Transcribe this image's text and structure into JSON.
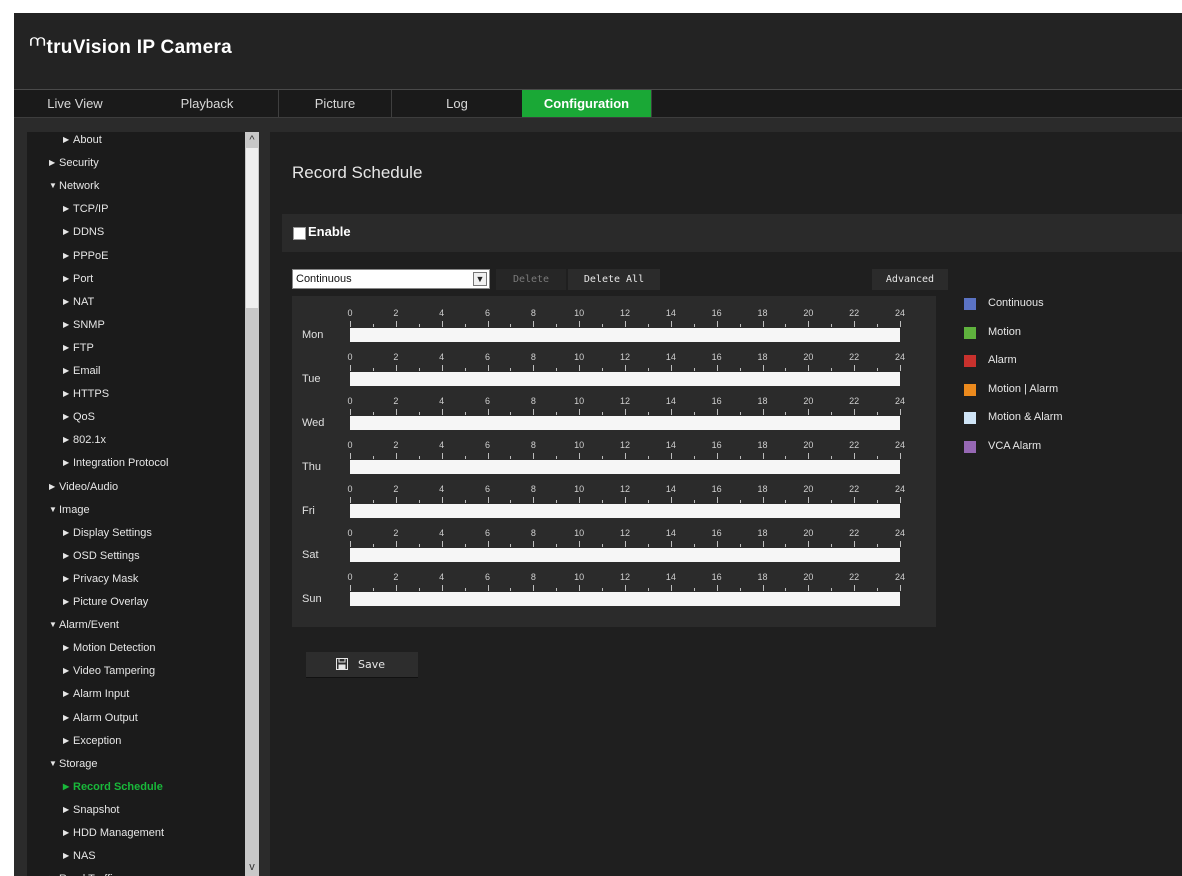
{
  "app": {
    "title": "truVision IP Camera",
    "logo_mark": "⩋"
  },
  "nav": {
    "tabs": [
      {
        "label": "Live View"
      },
      {
        "label": "Playback"
      },
      {
        "label": "Picture"
      },
      {
        "label": "Log"
      },
      {
        "label": "Configuration",
        "active": true
      }
    ]
  },
  "sidebar": {
    "items": [
      {
        "label": "About",
        "level": 1,
        "arrow": "▶"
      },
      {
        "label": "Security",
        "level": 0,
        "arrow": "▶"
      },
      {
        "label": "Network",
        "level": 0,
        "arrow": "▼"
      },
      {
        "label": "TCP/IP",
        "level": 1,
        "arrow": "▶"
      },
      {
        "label": "DDNS",
        "level": 1,
        "arrow": "▶"
      },
      {
        "label": "PPPoE",
        "level": 1,
        "arrow": "▶"
      },
      {
        "label": "Port",
        "level": 1,
        "arrow": "▶"
      },
      {
        "label": "NAT",
        "level": 1,
        "arrow": "▶"
      },
      {
        "label": "SNMP",
        "level": 1,
        "arrow": "▶"
      },
      {
        "label": "FTP",
        "level": 1,
        "arrow": "▶"
      },
      {
        "label": "Email",
        "level": 1,
        "arrow": "▶"
      },
      {
        "label": "HTTPS",
        "level": 1,
        "arrow": "▶"
      },
      {
        "label": "QoS",
        "level": 1,
        "arrow": "▶"
      },
      {
        "label": "802.1x",
        "level": 1,
        "arrow": "▶"
      },
      {
        "label": "Integration Protocol",
        "level": 1,
        "arrow": "▶"
      },
      {
        "label": "Video/Audio",
        "level": 0,
        "arrow": "▶"
      },
      {
        "label": "Image",
        "level": 0,
        "arrow": "▼"
      },
      {
        "label": "Display Settings",
        "level": 1,
        "arrow": "▶"
      },
      {
        "label": "OSD Settings",
        "level": 1,
        "arrow": "▶"
      },
      {
        "label": "Privacy Mask",
        "level": 1,
        "arrow": "▶"
      },
      {
        "label": "Picture Overlay",
        "level": 1,
        "arrow": "▶"
      },
      {
        "label": "Alarm/Event",
        "level": 0,
        "arrow": "▼"
      },
      {
        "label": "Motion Detection",
        "level": 1,
        "arrow": "▶"
      },
      {
        "label": "Video Tampering",
        "level": 1,
        "arrow": "▶"
      },
      {
        "label": "Alarm Input",
        "level": 1,
        "arrow": "▶"
      },
      {
        "label": "Alarm Output",
        "level": 1,
        "arrow": "▶"
      },
      {
        "label": "Exception",
        "level": 1,
        "arrow": "▶"
      },
      {
        "label": "Storage",
        "level": 0,
        "arrow": "▼"
      },
      {
        "label": "Record Schedule",
        "level": 1,
        "arrow": "▶",
        "active": true
      },
      {
        "label": "Snapshot",
        "level": 1,
        "arrow": "▶"
      },
      {
        "label": "HDD Management",
        "level": 1,
        "arrow": "▶"
      },
      {
        "label": "NAS",
        "level": 1,
        "arrow": "▶"
      },
      {
        "label": "Road Traffic",
        "level": 0,
        "arrow": "▶"
      }
    ]
  },
  "main": {
    "title": "Record Schedule",
    "enable_label": "Enable",
    "enabled": false,
    "record_type": "Continuous",
    "buttons": {
      "delete": "Delete",
      "delete_all": "Delete All",
      "advanced": "Advanced",
      "save": "Save"
    },
    "schedule": {
      "days": [
        "Mon",
        "Tue",
        "Wed",
        "Thu",
        "Fri",
        "Sat",
        "Sun"
      ],
      "hour_labels": [
        "0",
        "2",
        "4",
        "6",
        "8",
        "10",
        "12",
        "14",
        "16",
        "18",
        "20",
        "22",
        "24"
      ]
    },
    "legend": [
      {
        "label": "Continuous",
        "color": "#5b73c4"
      },
      {
        "label": "Motion",
        "color": "#5fb23d"
      },
      {
        "label": "Alarm",
        "color": "#c8312d"
      },
      {
        "label": "Motion | Alarm",
        "color": "#ec8a1d"
      },
      {
        "label": "Motion & Alarm",
        "color": "#cfe4f6"
      },
      {
        "label": "VCA Alarm",
        "color": "#9668b4"
      }
    ]
  }
}
